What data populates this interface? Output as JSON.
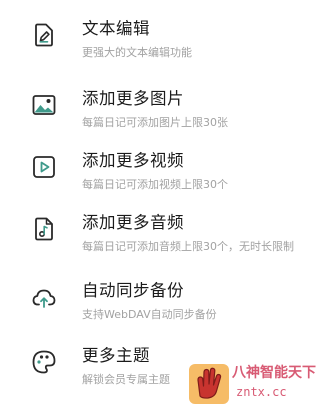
{
  "features": [
    {
      "title": "文本编辑",
      "desc": "更强大的文本编辑功能",
      "icon": "document-edit-icon"
    },
    {
      "title": "添加更多图片",
      "desc": "每篇日记可添加图片上限30张",
      "icon": "image-icon"
    },
    {
      "title": "添加更多视频",
      "desc": "每篇日记可添加视频上限30个",
      "icon": "video-play-icon"
    },
    {
      "title": "添加更多音频",
      "desc": "每篇日记可添加音频上限30个，无时长限制",
      "icon": "music-file-icon"
    },
    {
      "title": "自动同步备份",
      "desc": "支持WebDAV自动同步备份",
      "icon": "cloud-upload-icon"
    },
    {
      "title": "更多主题",
      "desc": "解锁会员专属主题",
      "icon": "palette-icon"
    }
  ],
  "watermark": {
    "title": "八神智能天下",
    "url": "zntx.cc"
  },
  "colors": {
    "icon_dark": "#2a2a2a",
    "icon_accent": "#3f9a8b",
    "title": "#1b1b1b",
    "desc": "#a2a2a2",
    "watermark": "#d85b74"
  }
}
